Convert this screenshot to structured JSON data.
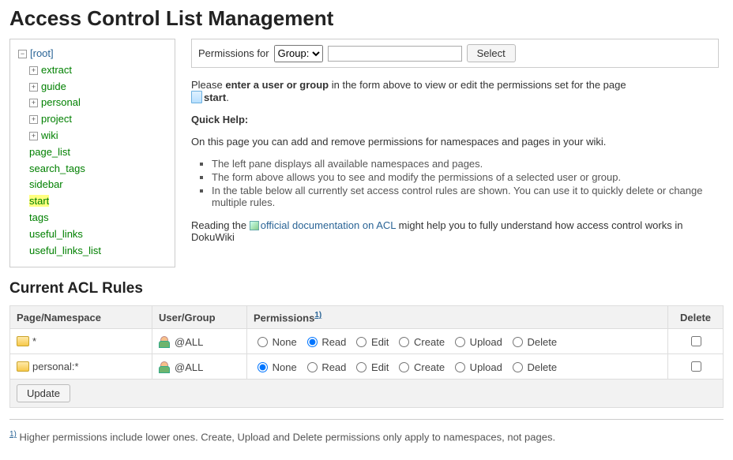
{
  "title": "Access Control List Management",
  "tree": {
    "root_label": "[root]",
    "namespaces": [
      "extract",
      "guide",
      "personal",
      "project",
      "wiki"
    ],
    "pages": [
      "page_list",
      "search_tags",
      "sidebar",
      "start",
      "tags",
      "useful_links",
      "useful_links_list"
    ],
    "selected": "start"
  },
  "permForm": {
    "label": "Permissions for",
    "selectOptions": [
      "Group:"
    ],
    "selectValue": "Group:",
    "inputValue": "",
    "selectBtn": "Select"
  },
  "intro": {
    "prefix": "Please ",
    "bold": "enter a user or group",
    "suffix": " in the form above to view or edit the permissions set for the page ",
    "page": "start",
    "period": "."
  },
  "quickHelp": {
    "heading": "Quick Help:",
    "lead": "On this page you can add and remove permissions for namespaces and pages in your wiki.",
    "items": [
      "The left pane displays all available namespaces and pages.",
      "The form above allows you to see and modify the permissions of a selected user or group.",
      "In the table below all currently set access control rules are shown. You can use it to quickly delete or change multiple rules."
    ],
    "reading_prefix": "Reading the ",
    "doc_link": "official documentation on ACL",
    "reading_suffix": " might help you to fully understand how access control works in DokuWiki"
  },
  "rulesHeading": "Current ACL Rules",
  "table": {
    "headers": {
      "page": "Page/Namespace",
      "user": "User/Group",
      "perm": "Permissions",
      "permNote": "1)",
      "delete": "Delete"
    },
    "permLabels": [
      "None",
      "Read",
      "Edit",
      "Create",
      "Upload",
      "Delete"
    ],
    "rows": [
      {
        "page": "*",
        "user": "@ALL",
        "selected": "Read"
      },
      {
        "page": "personal:*",
        "user": "@ALL",
        "selected": "None"
      }
    ],
    "updateBtn": "Update"
  },
  "footnote": {
    "marker": "1)",
    "text": " Higher permissions include lower ones. Create, Upload and Delete permissions only apply to namespaces, not pages."
  }
}
